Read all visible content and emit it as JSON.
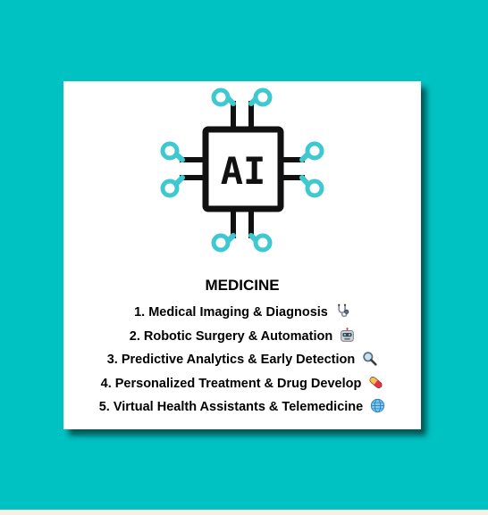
{
  "card": {
    "logo_text": "AI",
    "title": "MEDICINE",
    "items": [
      {
        "label": "1. Medical Imaging & Diagnosis",
        "icon": "stethoscope-icon"
      },
      {
        "label": "2. Robotic Surgery & Automation",
        "icon": "robot-icon"
      },
      {
        "label": "3. Predictive Analytics & Early Detection",
        "icon": "magnifier-icon"
      },
      {
        "label": "4. Personalized Treatment & Drug Develop",
        "icon": "pill-icon"
      },
      {
        "label": "5. Virtual Health Assistants & Telemedicine",
        "icon": "globe-icon"
      }
    ]
  },
  "colors": {
    "background": "#00c2c2",
    "card": "#ffffff",
    "circuit_accent": "#3ec8cf",
    "ink": "#111111"
  }
}
